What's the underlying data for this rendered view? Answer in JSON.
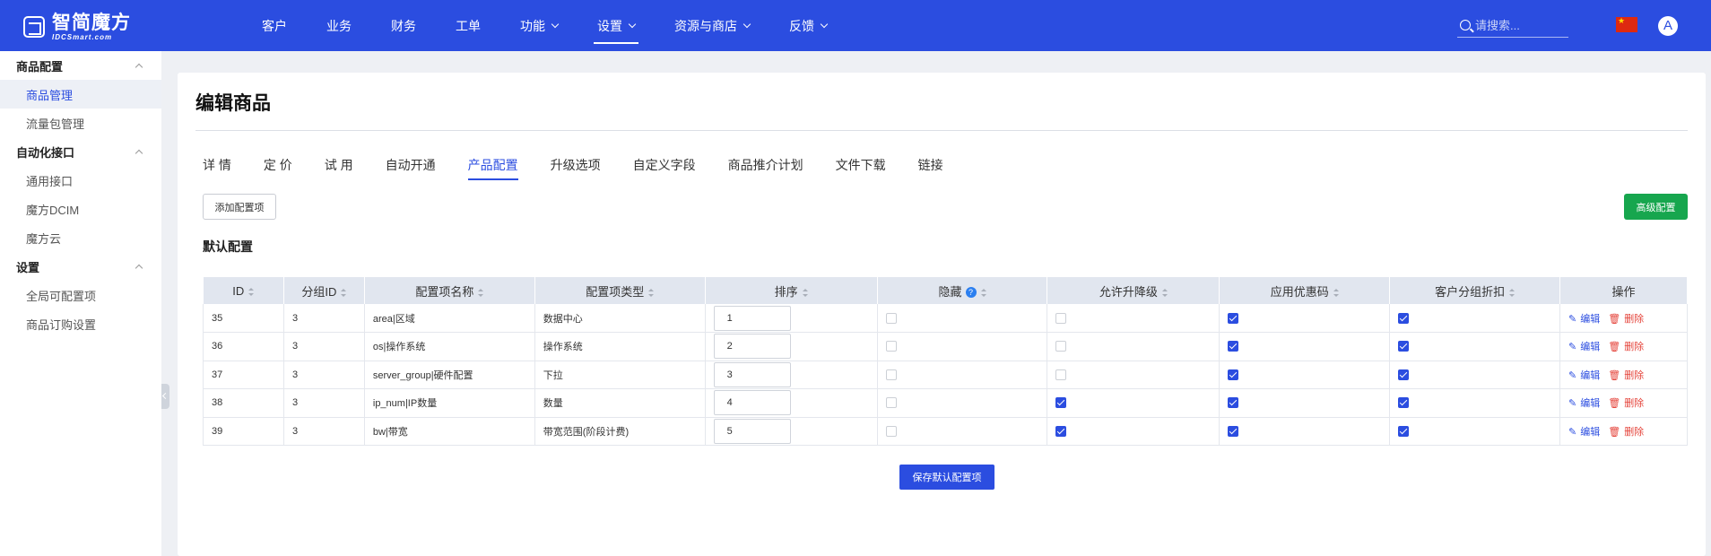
{
  "topbar": {
    "logo_cn": "智简魔方",
    "logo_en": "IDCSmart.com",
    "nav": [
      {
        "label": "客户",
        "dropdown": false,
        "active": false
      },
      {
        "label": "业务",
        "dropdown": false,
        "active": false
      },
      {
        "label": "财务",
        "dropdown": false,
        "active": false
      },
      {
        "label": "工单",
        "dropdown": false,
        "active": false
      },
      {
        "label": "功能",
        "dropdown": true,
        "active": false
      },
      {
        "label": "设置",
        "dropdown": true,
        "active": true
      },
      {
        "label": "资源与商店",
        "dropdown": true,
        "active": false
      },
      {
        "label": "反馈",
        "dropdown": true,
        "active": false
      }
    ],
    "search_placeholder": "请搜索...",
    "avatar_letter": "A"
  },
  "sidebar": {
    "groups": [
      {
        "label": "商品配置",
        "items": [
          {
            "label": "商品管理",
            "active": true
          },
          {
            "label": "流量包管理",
            "active": false
          }
        ]
      },
      {
        "label": "自动化接口",
        "items": [
          {
            "label": "通用接口",
            "active": false
          },
          {
            "label": "魔方DCIM",
            "active": false
          },
          {
            "label": "魔方云",
            "active": false
          }
        ]
      },
      {
        "label": "设置",
        "items": [
          {
            "label": "全局可配置项",
            "active": false
          },
          {
            "label": "商品订购设置",
            "active": false
          }
        ]
      }
    ]
  },
  "main": {
    "title": "编辑商品",
    "tabs": [
      {
        "label": "详 情",
        "active": false
      },
      {
        "label": "定 价",
        "active": false
      },
      {
        "label": "试 用",
        "active": false
      },
      {
        "label": "自动开通",
        "active": false
      },
      {
        "label": "产品配置",
        "active": true
      },
      {
        "label": "升级选项",
        "active": false
      },
      {
        "label": "自定义字段",
        "active": false
      },
      {
        "label": "商品推介计划",
        "active": false
      },
      {
        "label": "文件下载",
        "active": false
      },
      {
        "label": "链接",
        "active": false
      }
    ],
    "add_button": "添加配置项",
    "advanced_button": "高级配置",
    "section_title": "默认配置",
    "save_button": "保存默认配置项"
  },
  "table": {
    "headers": {
      "id": "ID",
      "group_id": "分组ID",
      "name": "配置项名称",
      "type": "配置项类型",
      "order": "排序",
      "hidden": "隐藏",
      "upgrade": "允许升降级",
      "coupon": "应用优惠码",
      "discount": "客户分组折扣",
      "actions": "操作"
    },
    "edit_label": "编辑",
    "delete_label": "删除",
    "rows": [
      {
        "id": "35",
        "group_id": "3",
        "name": "area|区域",
        "type": "数据中心",
        "order": "1",
        "hidden": false,
        "upgrade": false,
        "coupon": true,
        "discount": true
      },
      {
        "id": "36",
        "group_id": "3",
        "name": "os|操作系统",
        "type": "操作系统",
        "order": "2",
        "hidden": false,
        "upgrade": false,
        "coupon": true,
        "discount": true
      },
      {
        "id": "37",
        "group_id": "3",
        "name": "server_group|硬件配置",
        "type": "下拉",
        "order": "3",
        "hidden": false,
        "upgrade": false,
        "coupon": true,
        "discount": true
      },
      {
        "id": "38",
        "group_id": "3",
        "name": "ip_num|IP数量",
        "type": "数量",
        "order": "4",
        "hidden": false,
        "upgrade": true,
        "coupon": true,
        "discount": true
      },
      {
        "id": "39",
        "group_id": "3",
        "name": "bw|带宽",
        "type": "带宽范围(阶段计费)",
        "order": "5",
        "hidden": false,
        "upgrade": true,
        "coupon": true,
        "discount": true
      }
    ]
  },
  "colors": {
    "primary": "#2b4de0",
    "success": "#17a64e",
    "danger": "#e5453c"
  }
}
